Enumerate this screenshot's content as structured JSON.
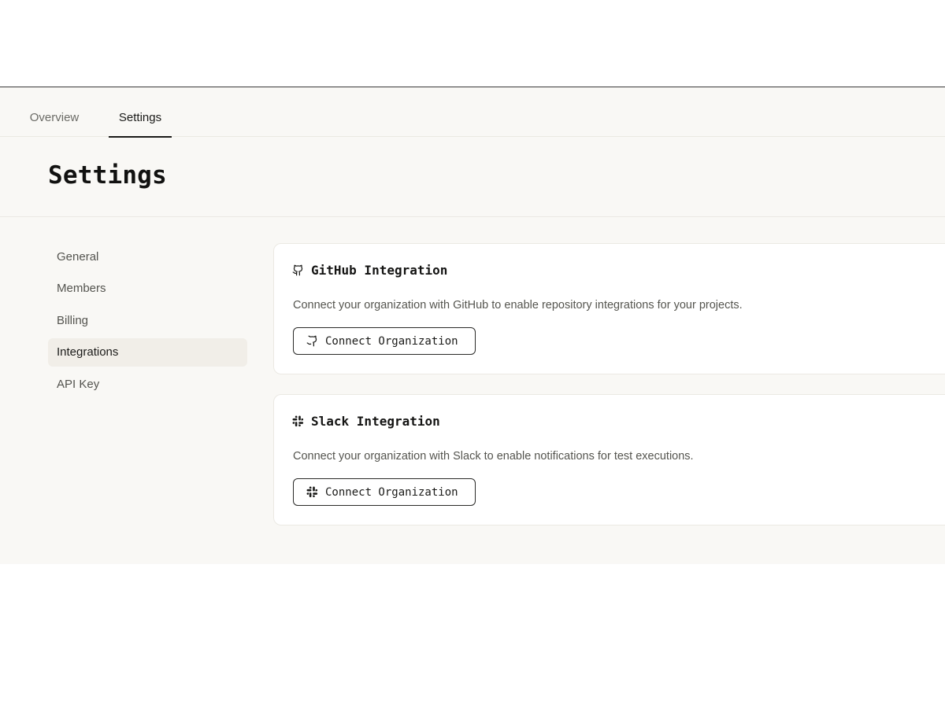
{
  "tabs": {
    "overview": "Overview",
    "settings": "Settings"
  },
  "header": {
    "title": "Settings"
  },
  "sidebar": {
    "items": [
      {
        "label": "General"
      },
      {
        "label": "Members"
      },
      {
        "label": "Billing"
      },
      {
        "label": "Integrations",
        "active": true
      },
      {
        "label": "API Key"
      }
    ]
  },
  "integrations": {
    "github": {
      "icon": "github-icon",
      "title": "GitHub Integration",
      "description": "Connect your organization with GitHub to enable repository integrations for your projects.",
      "button_label": "Connect Organization"
    },
    "slack": {
      "icon": "slack-icon",
      "title": "Slack Integration",
      "description": "Connect your organization with Slack to enable notifications for test executions.",
      "button_label": "Connect Organization"
    }
  },
  "colors": {
    "page_background": "#f9f8f5",
    "card_background": "#ffffff",
    "border": "#ebe9e3",
    "active_nav": "#f1eee8",
    "text_primary": "#1a1a18",
    "text_muted": "#55554f"
  }
}
